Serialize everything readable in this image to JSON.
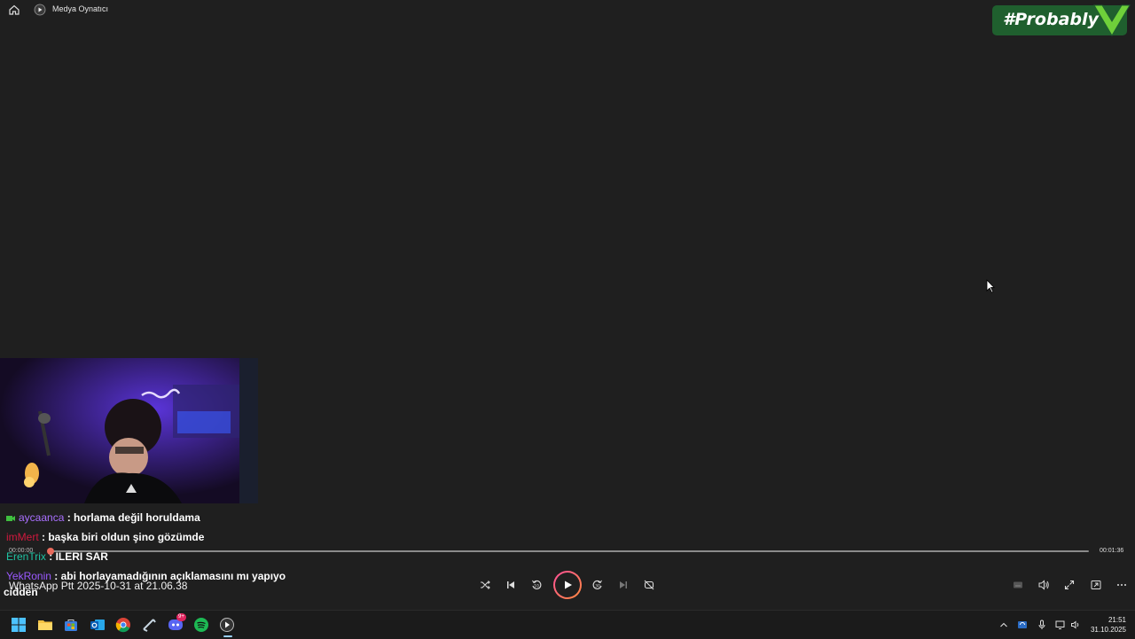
{
  "window": {
    "title": "Medya Oynatıcı"
  },
  "watermark": {
    "text": "#Probably"
  },
  "chat": [
    {
      "user": "aycaanca",
      "user_color": "#a970ff",
      "message": ": horlama değil horuldama"
    },
    {
      "user": "imMert",
      "user_color": "#d0193e",
      "message": ": başka biri oldun şino gözümde"
    },
    {
      "user": "ErenTrix",
      "user_color": "#1fc2a2",
      "message": ": ILERI SAR"
    },
    {
      "user": "YekRonin",
      "user_color": "#9b59ff",
      "message": ": abi horlayamadığının açıklamasını mı yapıyo"
    },
    {
      "continuation": "cidden"
    }
  ],
  "media": {
    "title": "WhatsApp Ptt 2025-10-31 at 21.06.38",
    "time_current": "00:00:00",
    "time_total": "00:01:36",
    "progress": 0.0
  },
  "controls": {
    "shuffle": "shuffle-icon",
    "previous": "previous-icon",
    "rewind": "rewind-10-icon",
    "play": "play-icon",
    "forward": "forward-30-icon",
    "next": "next-icon",
    "repeat": "repeat-off-icon",
    "subtitles": "subtitles-icon",
    "volume": "volume-icon",
    "fullscreen": "fullscreen-icon",
    "miniplayer": "miniplayer-icon",
    "more": "more-icon"
  },
  "taskbar": {
    "apps": [
      "windows-start",
      "file-explorer",
      "microsoft-store",
      "outlook",
      "chrome",
      "steam",
      "discord",
      "spotify",
      "media-player"
    ],
    "discord_badge": "9+",
    "time": "21:51",
    "date": "31.10.2025"
  },
  "colors": {
    "accent_gradient": [
      "#ff4f9a",
      "#ff8a3d"
    ],
    "badge_green": "#1f5f2e",
    "progress_thumb": "#e86a5c"
  }
}
